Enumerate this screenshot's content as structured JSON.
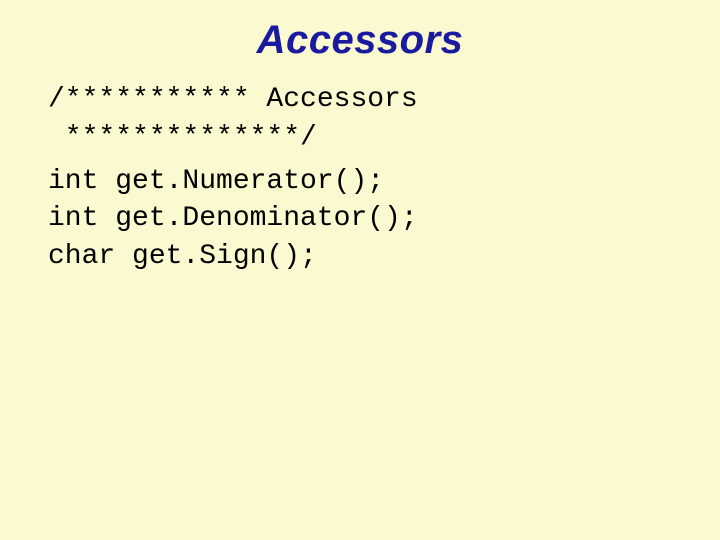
{
  "title": "Accessors",
  "comment_line1": "/*********** Accessors",
  "comment_line2": " **************/",
  "code_line1": "int get.Numerator();",
  "code_line2": "int get.Denominator();",
  "code_line3": "char get.Sign();"
}
